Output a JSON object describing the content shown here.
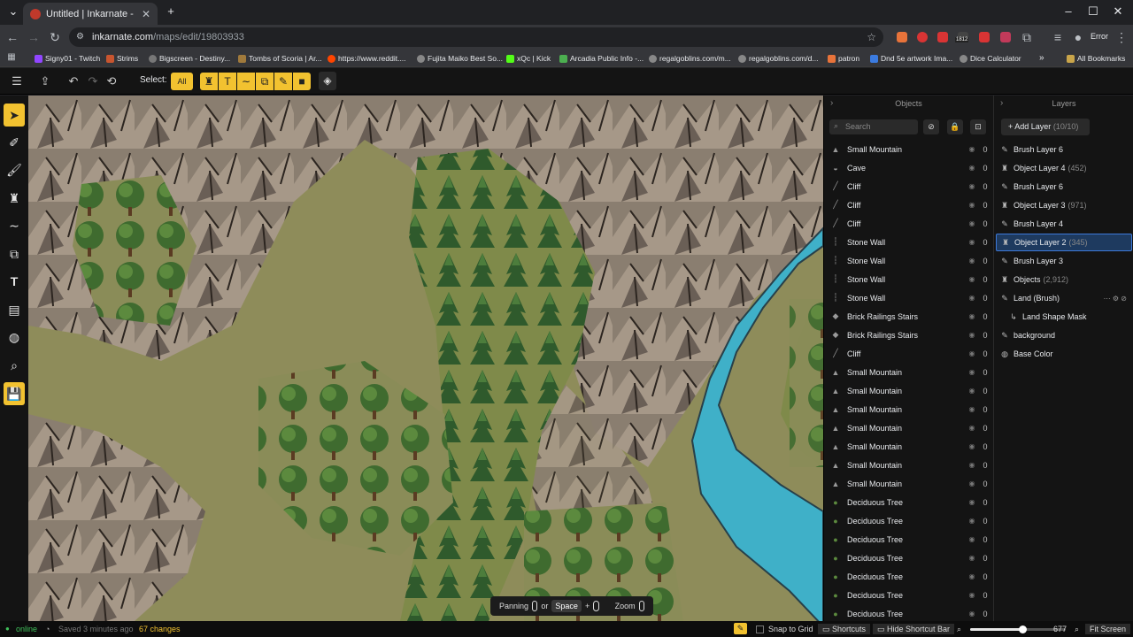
{
  "browser": {
    "tab_title": "Untitled | Inkarnate - Create Fa",
    "url_main": "inkarnate.com",
    "url_path": "/maps/edit/19803933",
    "profile_label": "Error",
    "bookmarks": [
      "Signy01 - Twitch",
      "Strims",
      "Bigscreen - Destiny...",
      "Tombs of Scoria | Ar...",
      "https://www.reddit....",
      "Fujita Maiko Best So...",
      "xQc | Kick",
      "Arcadia Public Info -...",
      "regalgoblins.com/m...",
      "regalgoblins.com/d...",
      "patron",
      "Dnd 5e artwork Ima...",
      "Dice Calculator"
    ],
    "all_bookmarks": "All Bookmarks",
    "ext_badge": "1812"
  },
  "toolbar": {
    "select_label": "Select:",
    "all_label": "All"
  },
  "objects_panel": {
    "title": "Objects",
    "search_placeholder": "Search",
    "items": [
      {
        "name": "Small Mountain",
        "count": "0"
      },
      {
        "name": "Cave",
        "count": "0"
      },
      {
        "name": "Cliff",
        "count": "0"
      },
      {
        "name": "Cliff",
        "count": "0"
      },
      {
        "name": "Cliff",
        "count": "0"
      },
      {
        "name": "Stone Wall",
        "count": "0"
      },
      {
        "name": "Stone Wall",
        "count": "0"
      },
      {
        "name": "Stone Wall",
        "count": "0"
      },
      {
        "name": "Stone Wall",
        "count": "0"
      },
      {
        "name": "Brick Railings Stairs",
        "count": "0"
      },
      {
        "name": "Brick Railings Stairs",
        "count": "0"
      },
      {
        "name": "Cliff",
        "count": "0"
      },
      {
        "name": "Small Mountain",
        "count": "0"
      },
      {
        "name": "Small Mountain",
        "count": "0"
      },
      {
        "name": "Small Mountain",
        "count": "0"
      },
      {
        "name": "Small Mountain",
        "count": "0"
      },
      {
        "name": "Small Mountain",
        "count": "0"
      },
      {
        "name": "Small Mountain",
        "count": "0"
      },
      {
        "name": "Small Mountain",
        "count": "0"
      },
      {
        "name": "Deciduous Tree",
        "count": "0"
      },
      {
        "name": "Deciduous Tree",
        "count": "0"
      },
      {
        "name": "Deciduous Tree",
        "count": "0"
      },
      {
        "name": "Deciduous Tree",
        "count": "0"
      },
      {
        "name": "Deciduous Tree",
        "count": "0"
      },
      {
        "name": "Deciduous Tree",
        "count": "0"
      },
      {
        "name": "Deciduous Tree",
        "count": "0"
      }
    ]
  },
  "layers_panel": {
    "title": "Layers",
    "add_label": "Add Layer",
    "add_count": "(10/10)",
    "items": [
      {
        "name": "Brush Layer 6",
        "count": "",
        "kind": "brush"
      },
      {
        "name": "Object Layer 4",
        "count": "(452)",
        "kind": "object"
      },
      {
        "name": "Brush Layer 6",
        "count": "",
        "kind": "brush"
      },
      {
        "name": "Object Layer 3",
        "count": "(971)",
        "kind": "object"
      },
      {
        "name": "Brush Layer 4",
        "count": "",
        "kind": "brush"
      },
      {
        "name": "Object Layer 2",
        "count": "(345)",
        "kind": "object",
        "selected": true
      },
      {
        "name": "Brush Layer 3",
        "count": "",
        "kind": "brush"
      },
      {
        "name": "Objects",
        "count": "(2,912)",
        "kind": "object"
      },
      {
        "name": "Land (Brush)",
        "count": "",
        "kind": "brush",
        "hover": true
      },
      {
        "name": "Land Shape Mask",
        "count": "",
        "kind": "mask"
      },
      {
        "name": "background",
        "count": "",
        "kind": "brush"
      },
      {
        "name": "Base Color",
        "count": "",
        "kind": "color"
      }
    ]
  },
  "shortcut_bar": {
    "panning": "Panning",
    "or": "or",
    "space": "Space",
    "plus": "+",
    "zoom": "Zoom"
  },
  "status_bar": {
    "online": "online",
    "saved": "Saved 3 minutes ago",
    "changes": "67 changes",
    "snap": "Snap to Grid",
    "shortcuts": "Shortcuts",
    "hide_shortcut": "Hide Shortcut Bar",
    "zoom_value": "677",
    "zoom_fraction": 0.55,
    "fit": "Fit Screen"
  },
  "colors": {
    "accent": "#f2c230",
    "selection": "#3d7ad9",
    "river": "#3fb0c8"
  }
}
